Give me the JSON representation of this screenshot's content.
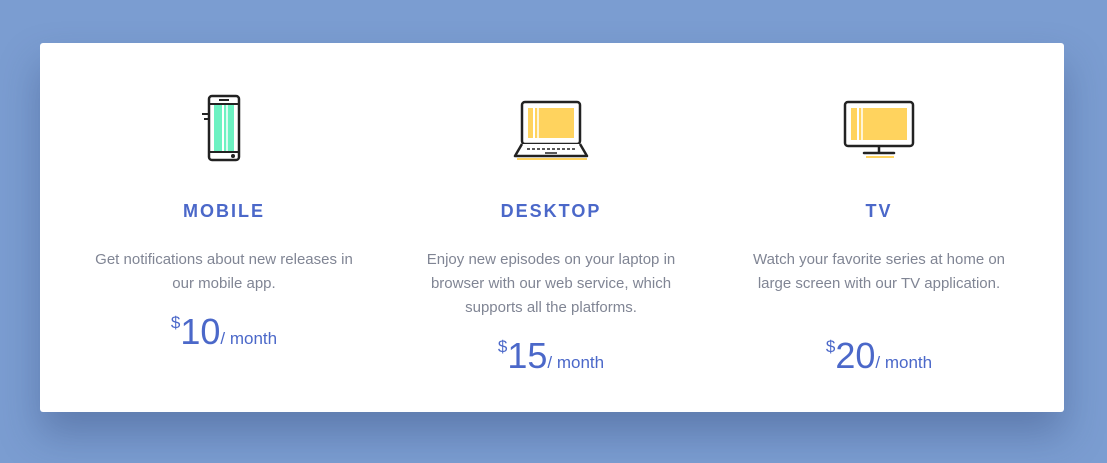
{
  "accent_color": "#4b68c9",
  "background_color": "#7b9dd1",
  "plans": [
    {
      "icon": "mobile-phone-icon",
      "title": "MOBILE",
      "description": "Get notifications about new releases in our mobile app.",
      "currency": "$",
      "amount": "10",
      "period": "/ month"
    },
    {
      "icon": "laptop-icon",
      "title": "DESKTOP",
      "description": "Enjoy new episodes on your laptop in browser with our web service, which supports all the platforms.",
      "currency": "$",
      "amount": "15",
      "period": "/ month"
    },
    {
      "icon": "tv-icon",
      "title": "TV",
      "description": "Watch your favorite series at home on large screen with our TV application.",
      "currency": "$",
      "amount": "20",
      "period": "/ month"
    }
  ]
}
